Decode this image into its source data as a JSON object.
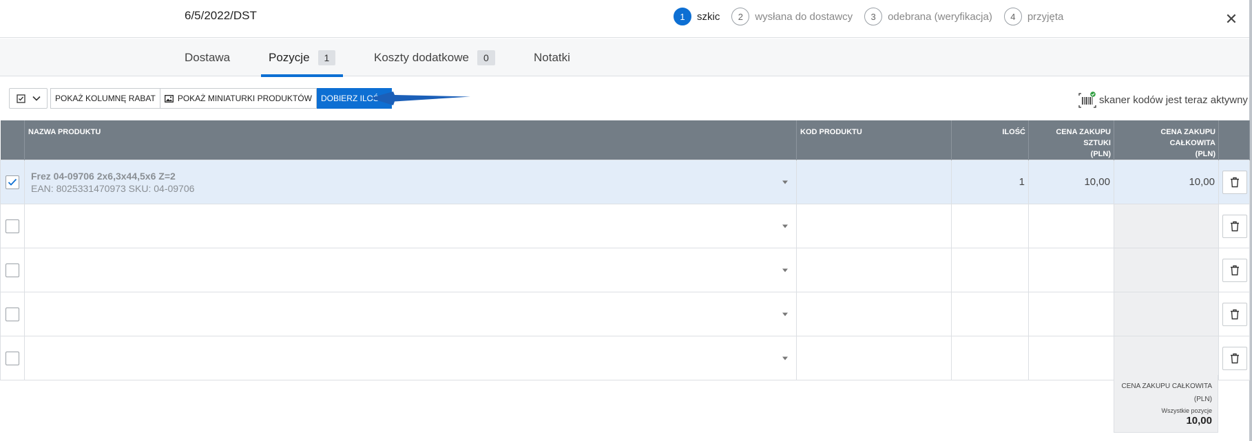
{
  "header": {
    "doc_number": "6/5/2022/DST",
    "steps": [
      {
        "number": "1",
        "label": "szkic",
        "active": true
      },
      {
        "number": "2",
        "label": "wysłana do dostawcy",
        "active": false
      },
      {
        "number": "3",
        "label": "odebrana (weryfikacja)",
        "active": false
      },
      {
        "number": "4",
        "label": "przyjęta",
        "active": false
      }
    ],
    "close_icon": "close-icon"
  },
  "tabs": [
    {
      "label": "Dostawa",
      "count": null
    },
    {
      "label": "Pozycje",
      "count": "1",
      "active": true
    },
    {
      "label": "Koszty dodatkowe",
      "count": "0"
    },
    {
      "label": "Notatki",
      "count": null
    }
  ],
  "toolbar": {
    "show_discount_label": "POKAŻ KOLUMNĘ RABAT",
    "show_thumbnails_label": "POKAŻ MINIATURKI PRODUKTÓW",
    "pick_quantities_label": "DOBIERZ ILOŚCI",
    "scanner_text": "skaner kodów jest teraz aktywny",
    "accent_color": "#0d6fd3"
  },
  "table": {
    "columns": {
      "name": "NAZWA PRODUKTU",
      "code": "KOD PRODUKTU",
      "qty": "ILOŚĆ",
      "unit_price": "CENA ZAKUPU SZTUKI",
      "unit_price_currency": "(PLN)",
      "total_price": "CENA ZAKUPU CAŁKOWITA",
      "total_price_currency": "(PLN)"
    },
    "rows": [
      {
        "checked": true,
        "name": "Frez 04-09706 2x6,3x44,5x6 Z=2",
        "sub": "EAN: 8025331470973 SKU: 04-09706",
        "code": "",
        "qty": "1",
        "unit_price": "10,00",
        "total": "10,00"
      },
      {
        "checked": false,
        "name": "",
        "sub": "",
        "code": "",
        "qty": "",
        "unit_price": "",
        "total": ""
      },
      {
        "checked": false,
        "name": "",
        "sub": "",
        "code": "",
        "qty": "",
        "unit_price": "",
        "total": ""
      },
      {
        "checked": false,
        "name": "",
        "sub": "",
        "code": "",
        "qty": "",
        "unit_price": "",
        "total": ""
      },
      {
        "checked": false,
        "name": "",
        "sub": "",
        "code": "",
        "qty": "",
        "unit_price": "",
        "total": ""
      }
    ]
  },
  "summary": {
    "label": "CENA ZAKUPU CAŁKOWITA",
    "currency": "(PLN)",
    "sub_label": "Wszystkie pozycje",
    "value": "10,00"
  }
}
